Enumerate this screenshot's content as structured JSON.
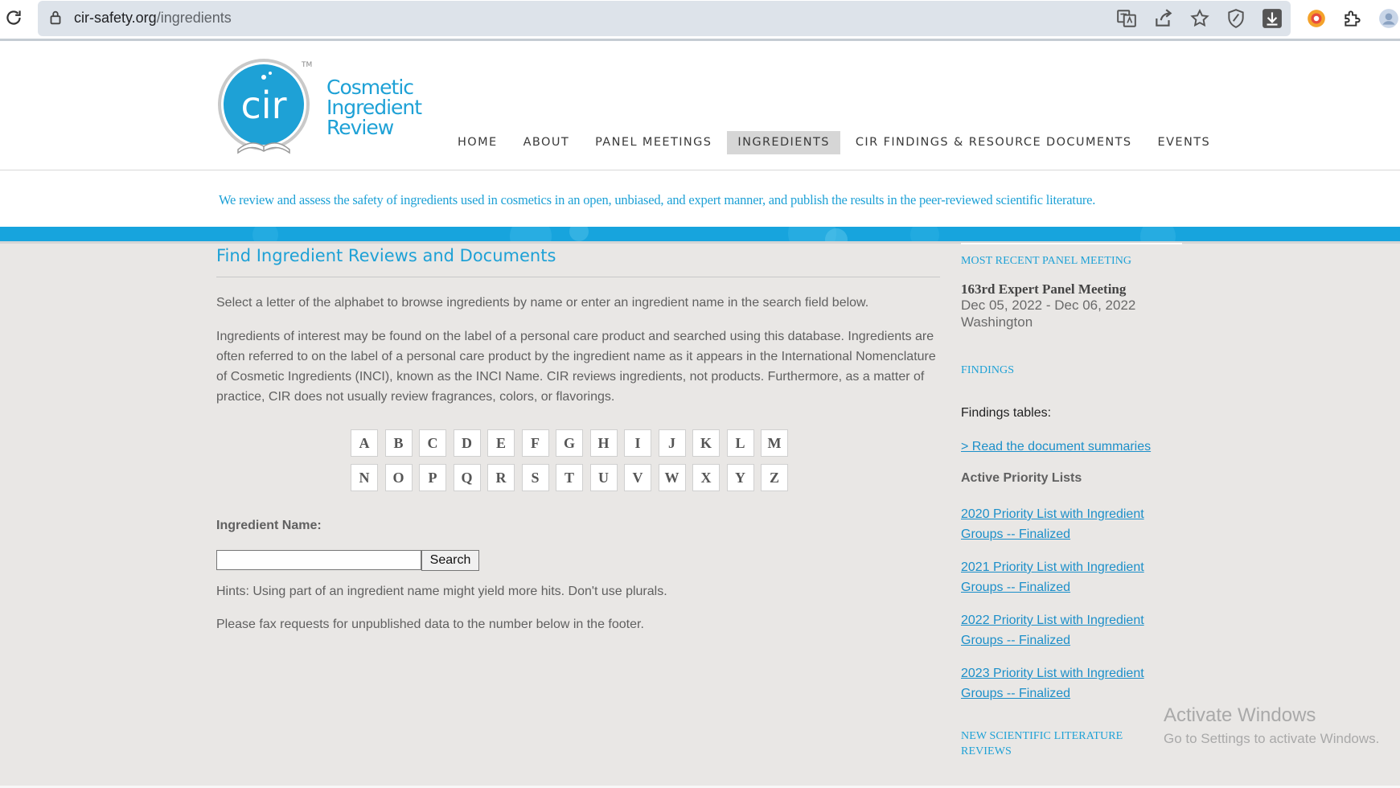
{
  "browser": {
    "url_host": "cir-safety.org",
    "url_path": "/ingredients"
  },
  "site": {
    "logo_text_line1": "Cosmetic",
    "logo_text_line2": "Ingredient",
    "logo_text_line3": "Review",
    "logo_mark": "cir",
    "logo_tm": "TM",
    "brand_color": "#1ea1d6"
  },
  "nav": {
    "items": [
      {
        "label": "HOME"
      },
      {
        "label": "ABOUT"
      },
      {
        "label": "PANEL MEETINGS"
      },
      {
        "label": "INGREDIENTS"
      },
      {
        "label": "CIR FINDINGS & RESOURCE DOCUMENTS"
      },
      {
        "label": "EVENTS"
      }
    ],
    "active": "INGREDIENTS"
  },
  "tagline": "We review and assess the safety of ingredients used in cosmetics in an open, unbiased, and expert manner, and publish the results in the peer-reviewed scientific literature.",
  "main": {
    "title": "Find Ingredient Reviews and Documents",
    "intro": "Select a letter of the alphabet to browse ingredients by name or enter an ingredient name in the search field below.",
    "description": "Ingredients of interest may be found on the label of a personal care product and searched using this database. Ingredients are often referred to on the label of a personal care product by the ingredient name as it appears in the International Nomenclature of Cosmetic Ingredients (INCI), known as the INCI Name. CIR reviews ingredients, not products. Furthermore, as a matter of practice, CIR does not usually review fragrances, colors, or flavorings.",
    "letters_row1": [
      "A",
      "B",
      "C",
      "D",
      "E",
      "F",
      "G",
      "H",
      "I",
      "J",
      "K",
      "L",
      "M"
    ],
    "letters_row2": [
      "N",
      "O",
      "P",
      "Q",
      "R",
      "S",
      "T",
      "U",
      "V",
      "W",
      "X",
      "Y",
      "Z"
    ],
    "search_label": "Ingredient Name:",
    "search_value": "",
    "search_button": "Search",
    "hint": "Hints: Using part of an ingredient name might yield more hits. Don't use plurals.",
    "fax_note": "Please fax requests for unpublished data to the number below in the footer."
  },
  "sidebar": {
    "recent_heading": "MOST RECENT PANEL MEETING",
    "meeting_title": "163rd Expert Panel Meeting",
    "meeting_dates": "Dec 05, 2022 - Dec 06, 2022",
    "meeting_location": "Washington",
    "findings_heading": "FINDINGS",
    "findings_tables": "Findings tables:",
    "read_summaries": "> Read the document summaries",
    "active_heading": "Active Priority Lists",
    "priority_lists": [
      {
        "label": "2020 Priority List with Ingredient Groups -- Finalized"
      },
      {
        "label": "2021 Priority List with Ingredient Groups -- Finalized"
      },
      {
        "label": "2022 Priority List with Ingredient Groups -- Finalized"
      },
      {
        "label": "2023 Priority List with Ingredient Groups -- Finalized"
      }
    ],
    "literature_heading": "NEW SCIENTIFIC LITERATURE REVIEWS"
  },
  "watermark": {
    "line1": "Activate Windows",
    "line2": "Go to Settings to activate Windows."
  },
  "icons": [
    "reload-icon",
    "lock-icon",
    "translate-icon",
    "share-icon",
    "star-icon",
    "shield-icon",
    "download-icon",
    "chrome-extension-icon",
    "puzzle-icon",
    "profile-icon"
  ]
}
